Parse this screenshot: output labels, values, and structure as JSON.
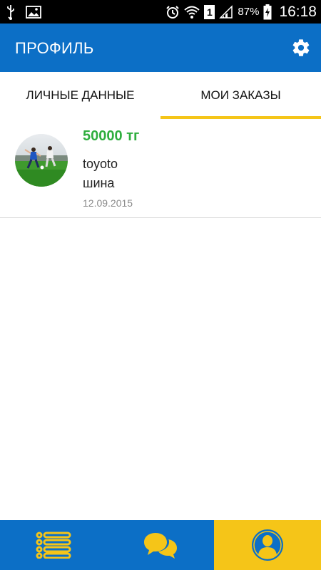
{
  "status_bar": {
    "battery_percent": "87%",
    "time": "16:18",
    "sim_slot": "1",
    "icons": [
      "usb-icon",
      "image-icon",
      "alarm-icon",
      "wifi-icon",
      "sim-icon",
      "signal-icon",
      "battery-charging-icon"
    ]
  },
  "app_bar": {
    "title": "ПРОФИЛЬ",
    "settings_icon": "gear-icon"
  },
  "tabs": [
    {
      "label": "ЛИЧНЫЕ ДАННЫЕ",
      "selected": false
    },
    {
      "label": "МОИ ЗАКАЗЫ",
      "selected": true
    }
  ],
  "orders": [
    {
      "price": "50000 тг",
      "brand": "toyoto",
      "part": "шина",
      "date": "12.09.2015",
      "thumbnail": "football-photo"
    }
  ],
  "bottom_nav": [
    {
      "name": "list-icon",
      "selected": false
    },
    {
      "name": "chat-icon",
      "selected": false
    },
    {
      "name": "profile-icon",
      "selected": true
    }
  ],
  "colors": {
    "primary": "#0c6fc6",
    "accent": "#f5c518",
    "price": "#2fae3e"
  }
}
